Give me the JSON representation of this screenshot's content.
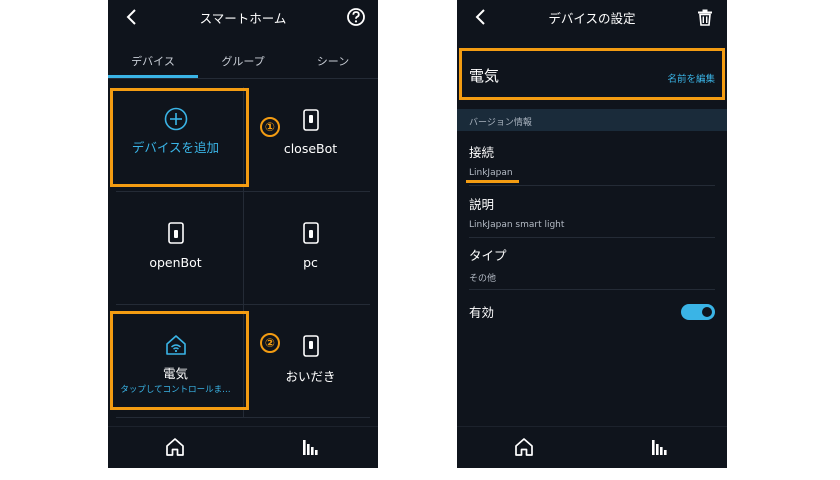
{
  "left_screen": {
    "title": "スマートホーム",
    "tabs": [
      {
        "label": "デバイス",
        "active": true
      },
      {
        "label": "グループ",
        "active": false
      },
      {
        "label": "シーン",
        "active": false
      }
    ],
    "add_device_label": "デバイスを追加",
    "devices": [
      {
        "label": "closeBot",
        "subtitle": ""
      },
      {
        "label": "openBot",
        "subtitle": ""
      },
      {
        "label": "pc",
        "subtitle": ""
      },
      {
        "label": "電気",
        "subtitle": "タップしてコントロールま…"
      },
      {
        "label": "おいだき",
        "subtitle": ""
      }
    ],
    "callouts": [
      "①",
      "②"
    ]
  },
  "right_screen": {
    "title": "デバイスの設定",
    "device_name": "電気",
    "edit_name_label": "名前を編集",
    "section_header": "バージョン情報",
    "rows": [
      {
        "title": "接続",
        "value": "LinkJapan"
      },
      {
        "title": "説明",
        "value": "LinkJapan smart light"
      },
      {
        "title": "タイプ",
        "value": "その他"
      }
    ],
    "enabled_label": "有効",
    "enabled": true
  },
  "colors": {
    "background": "#0f141c",
    "accent": "#3ab4e6",
    "highlight": "#f39c12",
    "section_header_bg": "#1a2b3a"
  },
  "icons": [
    "back-arrow-icon",
    "help-icon",
    "trash-icon",
    "plus-circle-icon",
    "switch-icon",
    "smart-home-wifi-icon",
    "home-icon",
    "equalizer-icon"
  ]
}
